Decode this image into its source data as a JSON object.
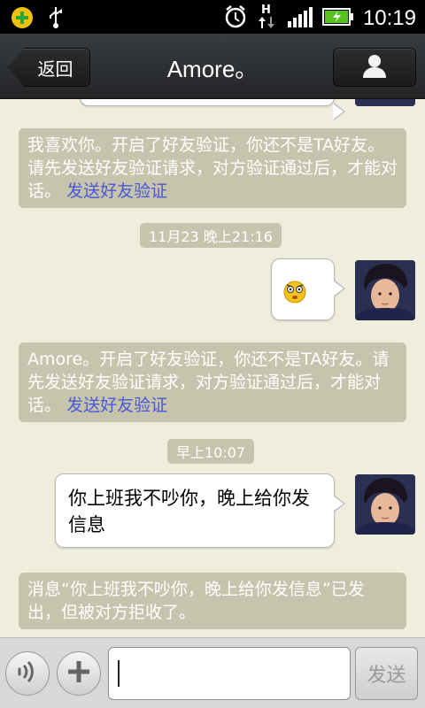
{
  "status_bar": {
    "time": "10:19",
    "network": "H"
  },
  "header": {
    "back_label": "返回",
    "title": "Amore。"
  },
  "messages": {
    "sys1": {
      "text": "我喜欢你。开启了好友验证，你还不是TA好友。请先发送好友验证请求，对方验证通过后，才能对话。",
      "link": "发送好友验证"
    },
    "ts1": "11月23 晚上21:16",
    "sys2": {
      "text": "Amore。开启了好友验证，你还不是TA好友。请先发送好友验证请求，对方验证通过后，才能对话。",
      "link": "发送好友验证"
    },
    "ts2": "早上10:07",
    "bubble_text": "你上班我不吵你，晚上给你发信息",
    "sys3": "消息“你上班我不吵你，晚上给你发信息”已发出，但被对方拒收了。"
  },
  "input_bar": {
    "value": "",
    "send_label": "发送"
  },
  "colors": {
    "background": "#efeddc",
    "system_bubble": "#c6c4ad",
    "link": "#4a57d6",
    "header": "#2a2c2e"
  },
  "icons": {
    "status_left": [
      "app-badge-icon",
      "usb-icon"
    ],
    "status_right": [
      "alarm-icon",
      "data-arrows-icon",
      "signal-icon",
      "battery-charging-icon"
    ],
    "header_right": "person-icon",
    "input_left": [
      "voice-icon",
      "add-icon"
    ]
  }
}
